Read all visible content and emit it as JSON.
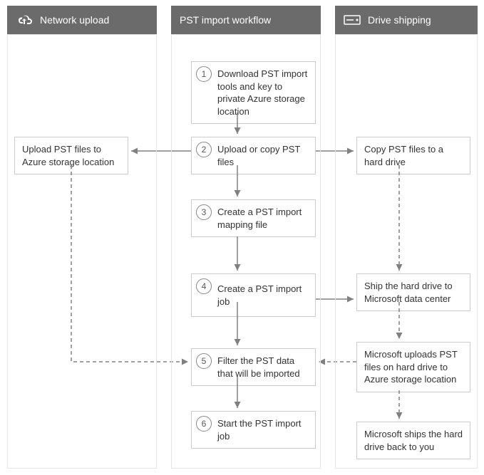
{
  "columns": {
    "left": {
      "title": "Network upload"
    },
    "center": {
      "title": "PST import workflow"
    },
    "right": {
      "title": "Drive shipping"
    }
  },
  "center_steps": [
    {
      "n": "1",
      "text": "Download PST import tools and key to private Azure storage location"
    },
    {
      "n": "2",
      "text": "Upload or copy PST files"
    },
    {
      "n": "3",
      "text": "Create a PST import mapping file"
    },
    {
      "n": "4",
      "text": "Create a PST import job"
    },
    {
      "n": "5",
      "text": "Filter the PST data that will be imported"
    },
    {
      "n": "6",
      "text": "Start the PST import job"
    }
  ],
  "left_boxes": [
    {
      "text": "Upload PST files to Azure storage location"
    }
  ],
  "right_boxes": [
    {
      "text": "Copy PST files to a hard drive"
    },
    {
      "text": "Ship the hard drive to Microsoft data center"
    },
    {
      "text": "Microsoft uploads PST files on hard drive to Azure storage location"
    },
    {
      "text": "Microsoft ships the hard drive back to you"
    }
  ]
}
